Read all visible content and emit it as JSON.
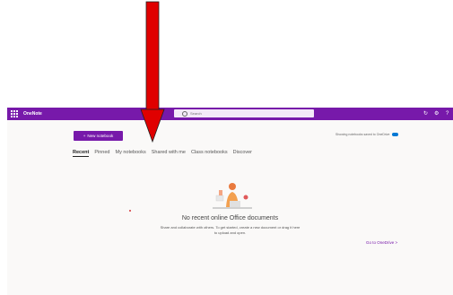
{
  "app": {
    "name": "OneNote"
  },
  "search": {
    "placeholder": "Search"
  },
  "header_icons": [
    "sync-icon",
    "settings-icon",
    "help-icon"
  ],
  "toolbar": {
    "new_notebook_label": "New notebook",
    "onedrive_note": "Showing notebooks saved to OneDrive"
  },
  "tabs": [
    {
      "label": "Recent",
      "active": true
    },
    {
      "label": "Pinned",
      "active": false
    },
    {
      "label": "My notebooks",
      "active": false
    },
    {
      "label": "Shared with me",
      "active": false
    },
    {
      "label": "Class notebooks",
      "active": false
    },
    {
      "label": "Discover",
      "active": false
    }
  ],
  "empty_state": {
    "title": "No recent online Office documents",
    "subtitle": "Share and collaborate with others. To get started, create a new document or drag it here",
    "link": "to upload and open."
  },
  "goto_onedrive": "Go to OneDrive  >",
  "colors": {
    "brand": "#7719aa",
    "arrow": "#e00000",
    "background": "#faf9f8"
  }
}
